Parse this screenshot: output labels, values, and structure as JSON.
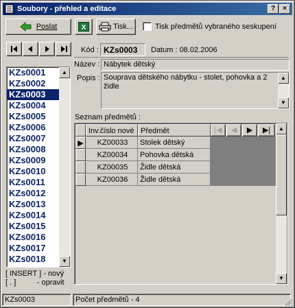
{
  "window": {
    "title": "Soubory - přehled a editace"
  },
  "toolbar": {
    "send_label": "Poslat",
    "print_label": "Tisk...",
    "print_group_checkbox_label": "Tisk předmětů vybraného seskupení",
    "print_group_checked": false
  },
  "record": {
    "code_label": "Kód :",
    "code_value": "KZs0003",
    "date_label": "Datum : 08.02.2006",
    "name_label": "Název :",
    "name_value": "Nábytek dětský",
    "desc_label": "Popis :",
    "desc_value": "Souprava dětského nábytku - stolet, pohovka a 2 židle"
  },
  "file_list": {
    "items": [
      "KZs0001",
      "KZs0002",
      "KZs0003",
      "KZs0004",
      "KZs0005",
      "KZs0006",
      "KZs0007",
      "KZs0008",
      "KZs0009",
      "KZs0010",
      "KZs0011",
      "KZs0012",
      "KZs0013",
      "KZs0014",
      "KZs0015",
      "KZs0016",
      "KZs0017",
      "KZs0018"
    ],
    "selected_index": 2
  },
  "hints": {
    "insert": "[ INSERT ] - nový",
    "edit": "[ . ]          - opravit"
  },
  "items_table": {
    "caption": "Seznam předmětů :",
    "columns": [
      "Inv.číslo nové",
      "Předmět"
    ],
    "rows": [
      [
        "KZ00033",
        "Stolek dětský"
      ],
      [
        "KZ00034",
        "Pohovka dětská"
      ],
      [
        "KZ00035",
        "Židle dětská"
      ],
      [
        "KZ00036",
        "Židle dětská"
      ]
    ],
    "current_row": 0
  },
  "status": {
    "left": "KZs0003",
    "right": "Počet předmětů - 4"
  }
}
